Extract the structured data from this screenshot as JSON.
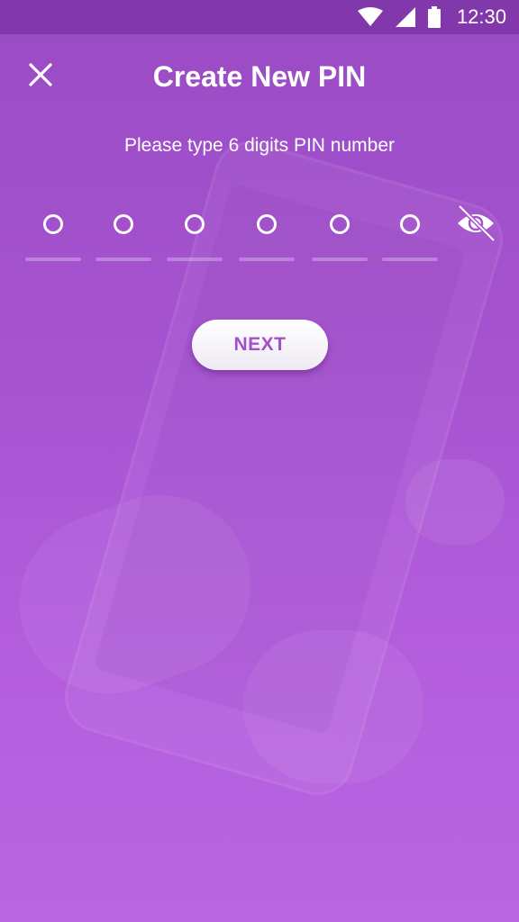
{
  "status_bar": {
    "time": "12:30",
    "icons": [
      "wifi-icon",
      "signal-icon",
      "battery-icon"
    ]
  },
  "header": {
    "title": "Create New PIN",
    "close_icon": "close-icon"
  },
  "pin": {
    "instruction": "Please type 6 digits PIN number",
    "length": 6,
    "entered": 0,
    "visibility_icon": "eye-off-icon"
  },
  "actions": {
    "next_label": "NEXT"
  },
  "colors": {
    "background_top": "#9a4cc4",
    "background_bottom": "#b966e2",
    "accent": "#a34fcd",
    "text": "#ffffff"
  }
}
